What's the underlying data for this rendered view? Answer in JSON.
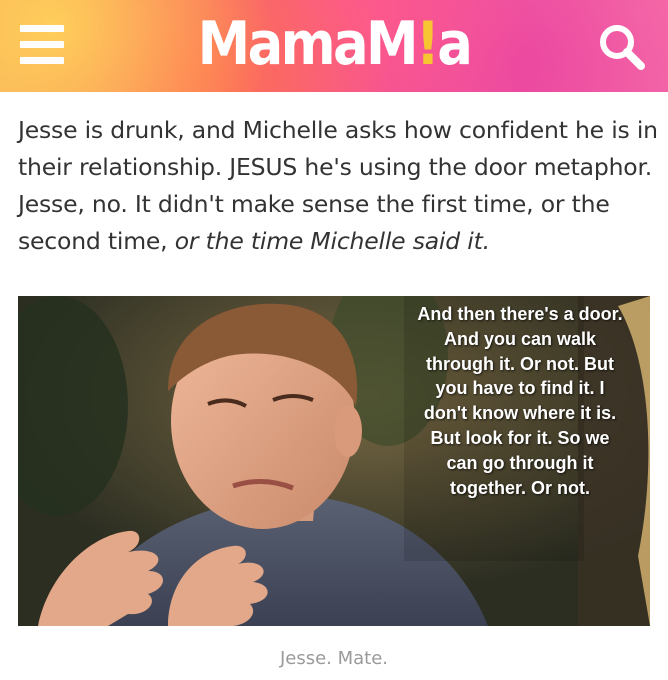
{
  "header": {
    "logo_main": "MamaM",
    "logo_dot": "!",
    "logo_end": "a",
    "menu_icon": "hamburger-menu-icon",
    "search_icon": "search-icon",
    "colors": {
      "gradient_left": "#f7a25a",
      "gradient_mid": "#ee4f97",
      "gradient_right": "#f06aa8",
      "logo_accent": "#f6c531"
    }
  },
  "article": {
    "paragraph_main": "Jesse is drunk, and Michelle asks how confident he is in their relationship. JESUS he's using the door metaphor. Jesse, no. It didn't make sense the first time, or the second time, ",
    "paragraph_italic": "or the time Michelle said it."
  },
  "image": {
    "overlay_text": "And then there's a door. And you can walk through it. Or not. But you have to find it. I don't know where it is. But look for it. So we can go through it together. Or not.",
    "caption": "Jesse. Mate."
  }
}
